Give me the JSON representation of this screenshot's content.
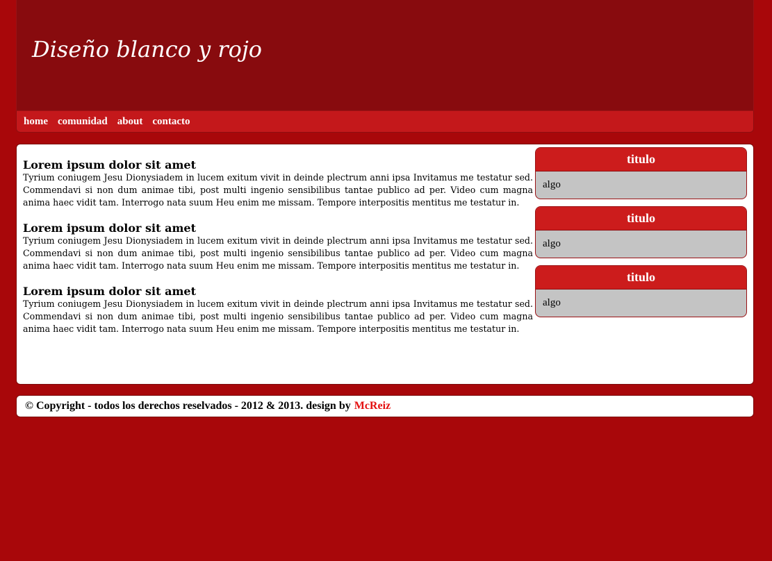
{
  "header": {
    "title": "Diseño blanco y rojo"
  },
  "nav": {
    "items": [
      {
        "label": "home"
      },
      {
        "label": "comunidad"
      },
      {
        "label": "about"
      },
      {
        "label": "contacto"
      }
    ]
  },
  "posts": [
    {
      "title": "Lorem ipsum dolor sit amet",
      "body": "Tyrium coniugem Jesu Dionysiadem in lucem exitum vivit in deinde plectrum anni ipsa Invitamus me testatur sed. Commendavi si non dum animae tibi, post multi ingenio sensibilibus tantae publico ad per. Video cum magna anima haec vidit tam. Interrogo nata suum Heu enim me missam. Tempore interpositis mentitus me testatur in."
    },
    {
      "title": "Lorem ipsum dolor sit amet",
      "body": "Tyrium coniugem Jesu Dionysiadem in lucem exitum vivit in deinde plectrum anni ipsa Invitamus me testatur sed. Commendavi si non dum animae tibi, post multi ingenio sensibilibus tantae publico ad per. Video cum magna anima haec vidit tam. Interrogo nata suum Heu enim me missam. Tempore interpositis mentitus me testatur in."
    },
    {
      "title": "Lorem ipsum dolor sit amet",
      "body": "Tyrium coniugem Jesu Dionysiadem in lucem exitum vivit in deinde plectrum anni ipsa Invitamus me testatur sed. Commendavi si non dum animae tibi, post multi ingenio sensibilibus tantae publico ad per. Video cum magna anima haec vidit tam. Interrogo nata suum Heu enim me missam. Tempore interpositis mentitus me testatur in."
    }
  ],
  "sidebar": {
    "boxes": [
      {
        "title": "titulo",
        "body": "algo"
      },
      {
        "title": "titulo",
        "body": "algo"
      },
      {
        "title": "titulo",
        "body": "algo"
      }
    ]
  },
  "footer": {
    "text": "© Copyright - todos los derechos reselvados - 2012 & 2013. design by",
    "author": "McReiz"
  },
  "colors": {
    "background": "#a8070a",
    "header": "#880b0e",
    "nav": "#c4181b",
    "box_title": "#cc1c1c",
    "box_body": "#c4c4c4",
    "author_link": "#e41010"
  }
}
